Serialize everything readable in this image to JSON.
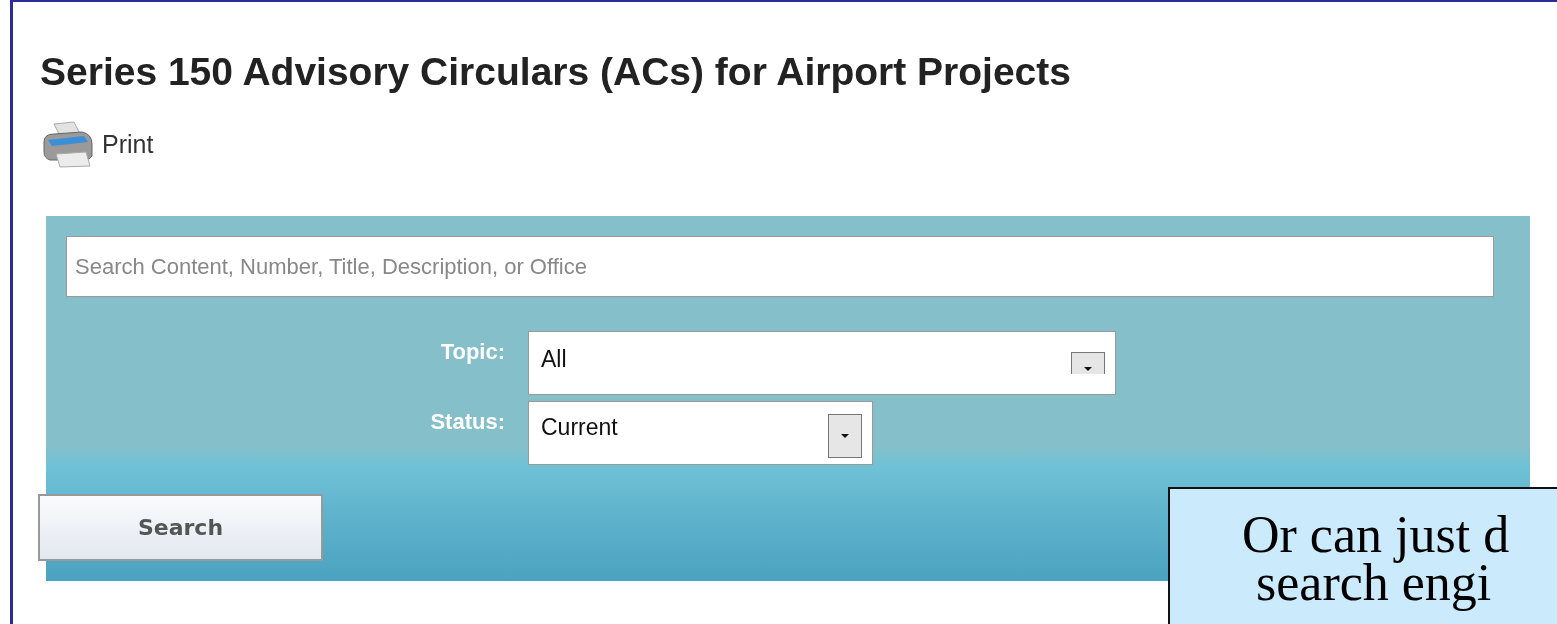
{
  "title": "Series 150 Advisory Circulars (ACs) for Airport Projects",
  "print": {
    "label": "Print"
  },
  "search": {
    "placeholder": "Search Content, Number, Title, Description, or Office"
  },
  "filters": [
    {
      "label": "Topic:",
      "value": "All"
    },
    {
      "label": "Status:",
      "value": "Current"
    }
  ],
  "search_button": "Search",
  "callout": {
    "lines": [
      "Or can just d",
      "search engi"
    ]
  }
}
